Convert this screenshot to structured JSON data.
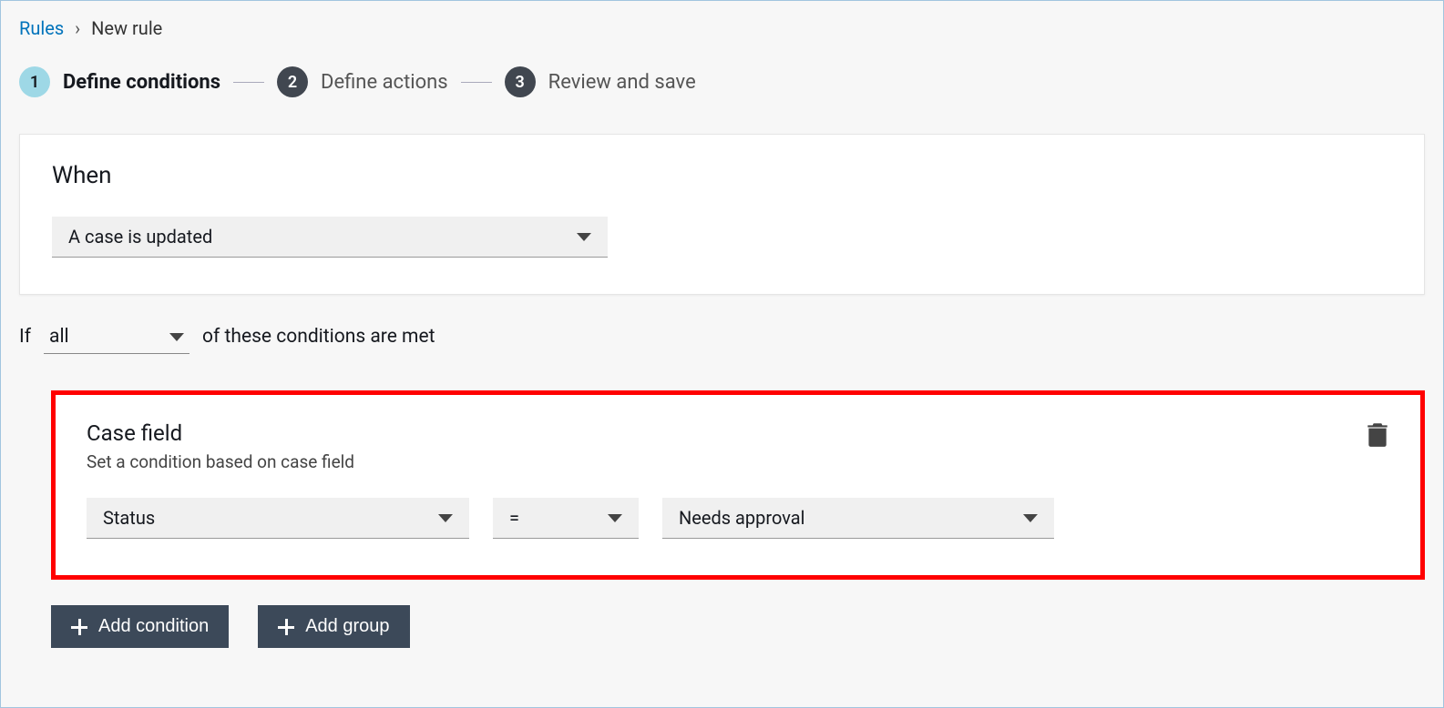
{
  "breadcrumb": {
    "root": "Rules",
    "current": "New rule"
  },
  "stepper": {
    "steps": [
      {
        "num": "1",
        "label": "Define conditions"
      },
      {
        "num": "2",
        "label": "Define actions"
      },
      {
        "num": "3",
        "label": "Review and save"
      }
    ]
  },
  "when": {
    "title": "When",
    "selected": "A case is updated"
  },
  "ifrow": {
    "prefix": "If",
    "match": "all",
    "suffix": "of these conditions are met"
  },
  "condition": {
    "title": "Case field",
    "subtitle": "Set a condition based on case field",
    "field": "Status",
    "operator": "=",
    "value": "Needs approval"
  },
  "actions": {
    "add_condition": "Add condition",
    "add_group": "Add group"
  }
}
